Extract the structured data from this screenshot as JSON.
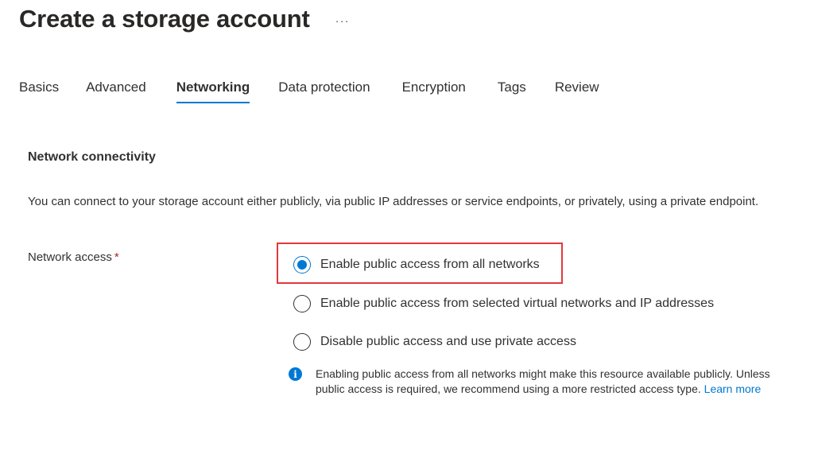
{
  "header": {
    "title": "Create a storage account",
    "more_label": "···"
  },
  "tabs": [
    {
      "label": "Basics",
      "active": false
    },
    {
      "label": "Advanced",
      "active": false
    },
    {
      "label": "Networking",
      "active": true
    },
    {
      "label": "Data protection",
      "active": false
    },
    {
      "label": "Encryption",
      "active": false
    },
    {
      "label": "Tags",
      "active": false
    },
    {
      "label": "Review",
      "active": false
    }
  ],
  "section": {
    "heading": "Network connectivity",
    "description": "You can connect to your storage account either publicly, via public IP addresses or service endpoints, or privately, using a private endpoint."
  },
  "network_access": {
    "label": "Network access",
    "required_marker": "*",
    "options": [
      {
        "label": "Enable public access from all networks",
        "selected": true
      },
      {
        "label": "Enable public access from selected virtual networks and IP addresses",
        "selected": false
      },
      {
        "label": "Disable public access and use private access",
        "selected": false
      }
    ],
    "info": {
      "icon": "info-icon",
      "text": "Enabling public access from all networks might make this resource available publicly. Unless public access is required, we recommend using a more restricted access type.",
      "link_label": "Learn more"
    }
  },
  "colors": {
    "accent": "#0078d4",
    "highlight_border": "#e0393e",
    "required": "#a4262c"
  }
}
